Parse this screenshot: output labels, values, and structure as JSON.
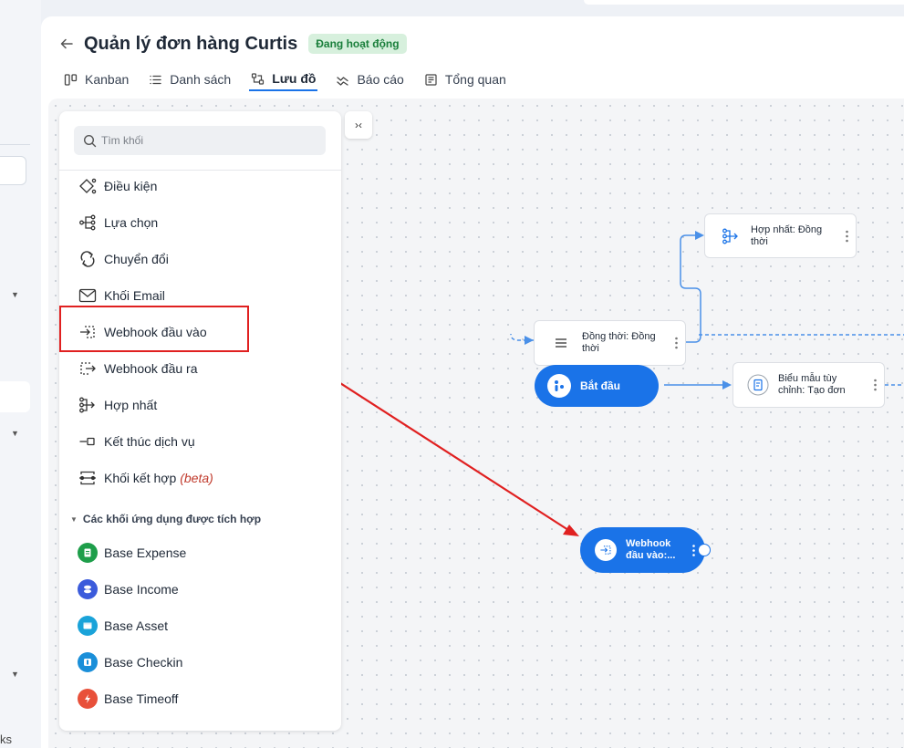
{
  "header": {
    "title": "Quản lý đơn hàng Curtis",
    "status": "Đang hoạt động"
  },
  "tabs": [
    {
      "label": "Kanban",
      "icon": "kanban-icon"
    },
    {
      "label": "Danh sách",
      "icon": "list-icon"
    },
    {
      "label": "Lưu đồ",
      "icon": "flow-icon",
      "active": true
    },
    {
      "label": "Báo cáo",
      "icon": "report-icon"
    },
    {
      "label": "Tổng quan",
      "icon": "overview-icon"
    }
  ],
  "panel": {
    "search_placeholder": "Tìm khối",
    "blocks": [
      {
        "label": "Điều kiện",
        "icon": "condition-icon"
      },
      {
        "label": "Lựa chọn",
        "icon": "choice-icon"
      },
      {
        "label": "Chuyển đổi",
        "icon": "convert-icon"
      },
      {
        "label": "Khối Email",
        "icon": "email-icon"
      },
      {
        "label": "Webhook đầu vào",
        "icon": "webhook-in-icon"
      },
      {
        "label": "Webhook đầu ra",
        "icon": "webhook-out-icon"
      },
      {
        "label": "Hợp nhất",
        "icon": "merge-icon"
      },
      {
        "label": "Kết thúc dịch vụ",
        "icon": "end-service-icon"
      },
      {
        "label": "Khối kết hợp",
        "icon": "combine-icon",
        "suffix": "(beta)"
      }
    ],
    "apps_section": "Các khối ứng dụng được tích hợp",
    "apps": [
      {
        "label": "Base Expense",
        "color": "#1e9e4a"
      },
      {
        "label": "Base Income",
        "color": "#3b5bdb"
      },
      {
        "label": "Base Asset",
        "color": "#1aa3d9"
      },
      {
        "label": "Base Checkin",
        "color": "#1a8fd9"
      },
      {
        "label": "Base Timeoff",
        "color": "#e8503a"
      }
    ]
  },
  "flow": {
    "merge_node": "Hợp nhất: Đồng thời",
    "parallel_node": "Đồng thời: Đồng thời",
    "start_node": "Bắt đầu",
    "form_node": "Biểu mẫu tùy chỉnh: Tạo đơn",
    "webhook_node": "Webhook đầu vào:..."
  },
  "sidebar": {
    "footer_text": "ks"
  },
  "colors": {
    "accent": "#1a73e8",
    "annotation": "#e02020",
    "status_bg": "#d7f0dd",
    "status_text": "#1a7f3b"
  }
}
